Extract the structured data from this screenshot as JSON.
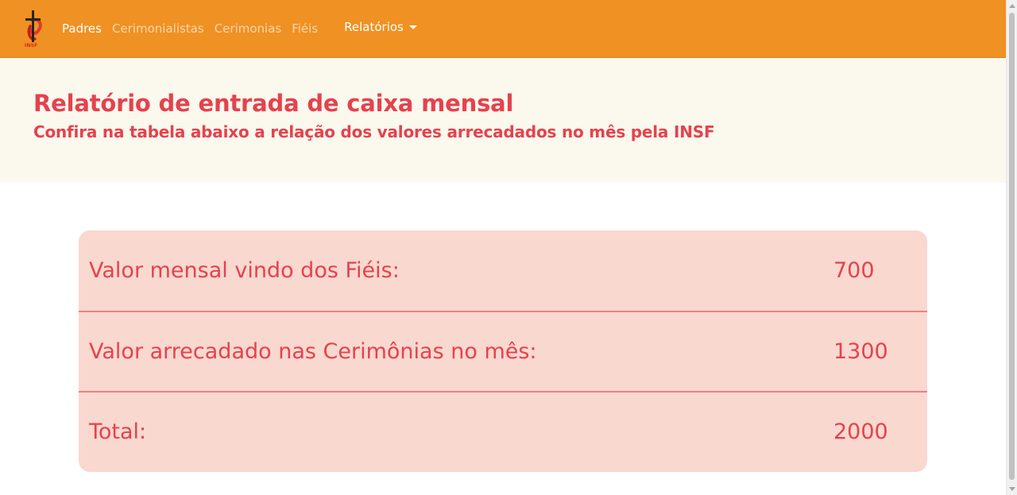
{
  "brand": {
    "logo_text": "INSF",
    "colors": {
      "navbar": "#ef9123",
      "accent": "#e5424d",
      "jumbotron_bg": "#fbf8ee",
      "card_bg": "#f9d8cf",
      "divider": "#ef7f84"
    }
  },
  "nav": {
    "items": [
      {
        "label": "Padres",
        "active": true
      },
      {
        "label": "Cerimonialistas",
        "active": false
      },
      {
        "label": "Cerimonias",
        "active": false
      },
      {
        "label": "Fiéis",
        "active": false
      }
    ],
    "dropdown": {
      "label": "Relatórios",
      "icon": "caret-down-icon"
    }
  },
  "header": {
    "title": "Relatório de entrada de caixa mensal",
    "subtitle": "Confira na tabela abaixo a relação dos valores arrecadados no mês pela INSF"
  },
  "report": {
    "rows": [
      {
        "label": "Valor mensal vindo dos Fiéis:",
        "value": "700"
      },
      {
        "label": "Valor arrecadado nas Cerimônias no mês:",
        "value": "1300"
      },
      {
        "label": "Total:",
        "value": "2000"
      }
    ]
  }
}
